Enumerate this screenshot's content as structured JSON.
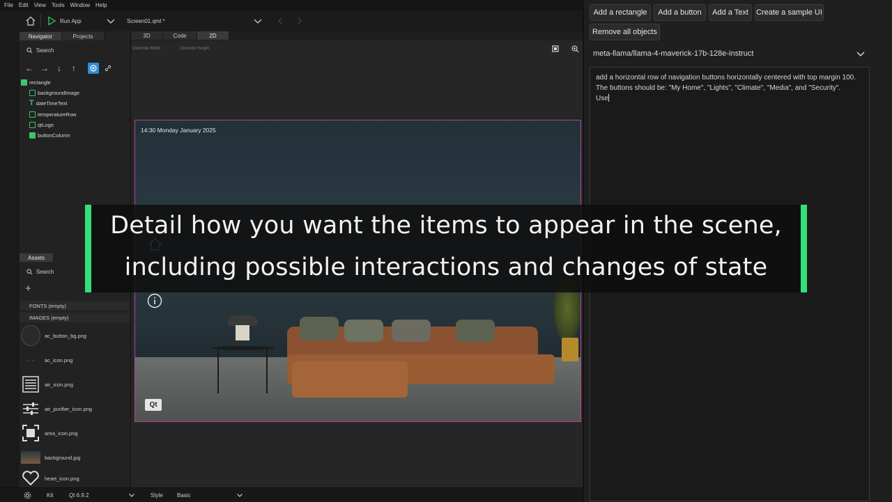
{
  "menu": [
    "File",
    "Edit",
    "View",
    "Tools",
    "Window",
    "Help"
  ],
  "toolbar": {
    "run_label": "Run App",
    "file_name": "Screen01.qml",
    "modified_marker": "*"
  },
  "left_tabs": [
    "Navigator",
    "Projects"
  ],
  "view_tabs": [
    "3D",
    "Code",
    "2D"
  ],
  "active_view_tab": "2D",
  "navigator": {
    "search_label": "Search",
    "tree": [
      {
        "label": "rectangle",
        "icon": "rectangle-icon"
      },
      {
        "label": "backgroundImage",
        "icon": "image-icon"
      },
      {
        "label": "dateTimeText",
        "icon": "text-icon"
      },
      {
        "label": "temperatureRow",
        "icon": "row-icon"
      },
      {
        "label": "qtLogo",
        "icon": "image-icon"
      },
      {
        "label": "buttonColumn",
        "icon": "column-icon"
      }
    ]
  },
  "center_bar": {
    "override_width": "Override Width",
    "override_height": "Override Height"
  },
  "canvas": {
    "datetime": "14:30 Monday January 2025",
    "logo": "Qt"
  },
  "assets": {
    "tab_label": "Assets",
    "search_label": "Search",
    "fonts_label": "FONTS (empty)",
    "images_label": "IMAGES (empty)",
    "files": [
      {
        "name": "ac_button_bg.png",
        "icon": "circle-thumb-icon"
      },
      {
        "name": "ac_icon.png",
        "icon": "dots-thumb-icon"
      },
      {
        "name": "air_icon.png",
        "icon": "lines-thumb-icon"
      },
      {
        "name": "air_purifier_icon.png",
        "icon": "sliders-thumb-icon"
      },
      {
        "name": "area_icon.png",
        "icon": "area-thumb-icon"
      },
      {
        "name": "background.jpg",
        "icon": "photo-thumb-icon"
      },
      {
        "name": "heart_icon.png",
        "icon": "heart-thumb-icon"
      }
    ]
  },
  "status": {
    "kit_label": "Kit",
    "kit_value": "Qt 6.9.2",
    "style_label": "Style",
    "style_value": "Basic"
  },
  "ai_panel": {
    "buttons": [
      "Add a rectangle",
      "Add a button",
      "Add a Text",
      "Create a sample UI",
      "Remove all objects"
    ],
    "model": "meta-llama/llama-4-maverick-17b-128e-instruct",
    "prompt_text": "add a horizontal row of navigation buttons horizontally centered with top margin 100.\nThe buttons should be: \"My Home\", \"Lights\", \"Climate\", \"Media\", and \"Security\".\nUse"
  },
  "subtitle": {
    "line1": "Detail how you want the items to appear in the scene,",
    "line2": "including possible interactions and changes of state"
  },
  "colors": {
    "accent_green": "#33e07a",
    "selection_border": "#b0469b",
    "active_tool": "#2e8fd6"
  }
}
